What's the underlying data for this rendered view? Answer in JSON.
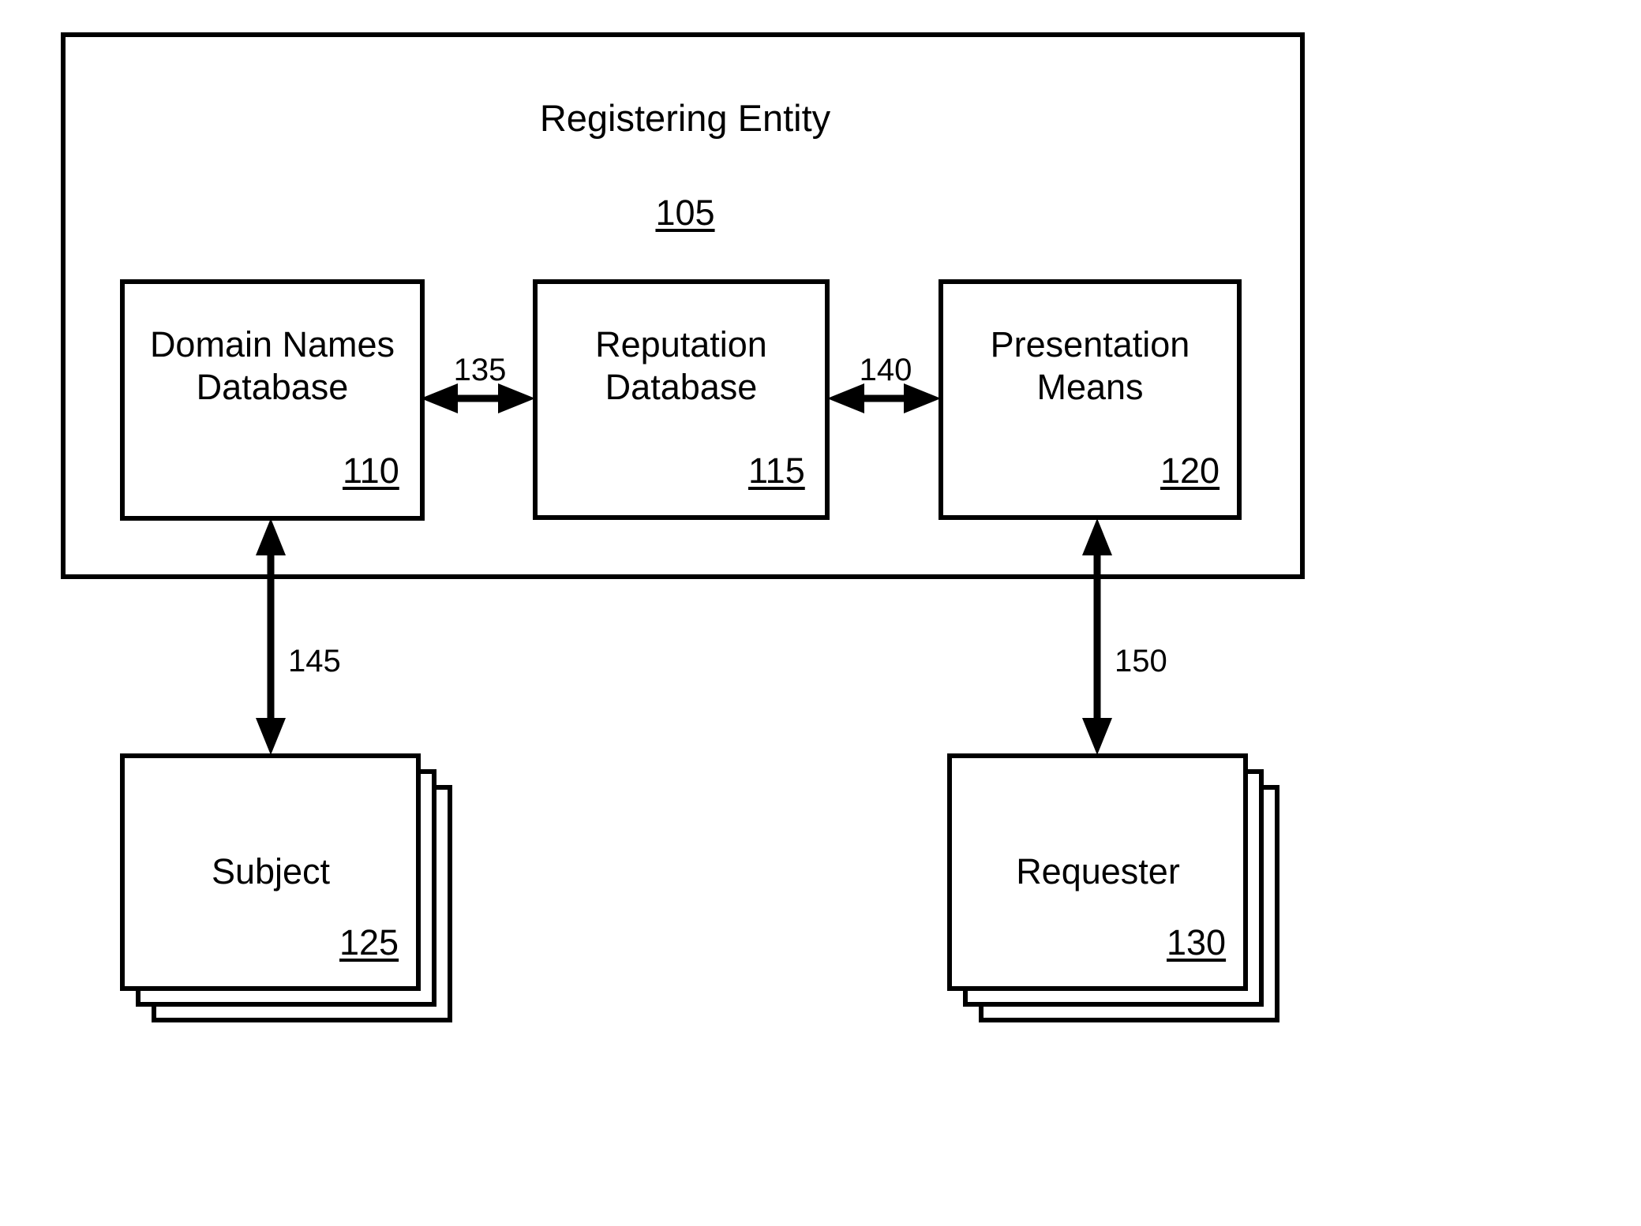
{
  "diagram": {
    "container": {
      "title": "Registering Entity",
      "ref": "105"
    },
    "boxes": [
      {
        "id": "domain-names-database",
        "line1": "Domain Names",
        "line2": "Database",
        "ref": "110"
      },
      {
        "id": "reputation-database",
        "line1": "Reputation",
        "line2": "Database",
        "ref": "115"
      },
      {
        "id": "presentation-means",
        "line1": "Presentation",
        "line2": "Means",
        "ref": "120"
      }
    ],
    "stacks": [
      {
        "id": "subject",
        "label": "Subject",
        "ref": "125"
      },
      {
        "id": "requester",
        "label": "Requester",
        "ref": "130"
      }
    ],
    "connectors": [
      {
        "id": "connector-135",
        "ref": "135",
        "from": "domain-names-database",
        "to": "reputation-database",
        "style": "double-arrow-horizontal"
      },
      {
        "id": "connector-140",
        "ref": "140",
        "from": "reputation-database",
        "to": "presentation-means",
        "style": "double-arrow-horizontal"
      },
      {
        "id": "connector-145",
        "ref": "145",
        "from": "domain-names-database",
        "to": "subject",
        "style": "double-arrow-vertical"
      },
      {
        "id": "connector-150",
        "ref": "150",
        "from": "presentation-means",
        "to": "requester",
        "style": "double-arrow-vertical"
      }
    ],
    "colors": {
      "stroke": "#000000",
      "background": "#ffffff"
    }
  }
}
